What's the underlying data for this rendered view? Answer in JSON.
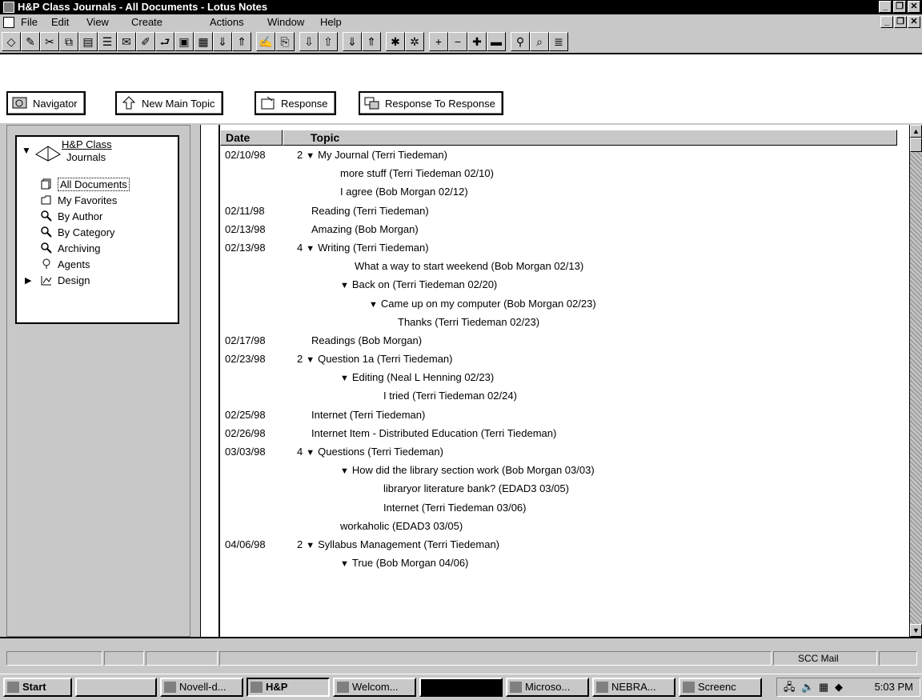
{
  "window": {
    "title": "H&P Class Journals - All Documents - Lotus Notes"
  },
  "menu": [
    {
      "label": "File"
    },
    {
      "label": "Edit"
    },
    {
      "label": "View"
    },
    {
      "label": "Create"
    },
    {
      "label": "Actions"
    },
    {
      "label": "Window"
    },
    {
      "label": "Help"
    }
  ],
  "action_buttons": [
    {
      "label": "Navigator"
    },
    {
      "label": "New Main Topic"
    },
    {
      "label": "Response"
    },
    {
      "label": "Response To Response"
    }
  ],
  "navigator": {
    "db_title_1": "H&P Class",
    "db_title_2": "Journals",
    "items": [
      {
        "label": "All Documents",
        "icon": "documents-icon",
        "selected": true
      },
      {
        "label": "My Favorites",
        "icon": "folder-icon"
      },
      {
        "label": "By Author",
        "icon": "magnifier-icon"
      },
      {
        "label": "By Category",
        "icon": "magnifier-icon"
      },
      {
        "label": "Archiving",
        "icon": "magnifier-icon"
      },
      {
        "label": "Agents",
        "icon": "agent-icon"
      },
      {
        "label": "Design",
        "icon": "design-icon"
      }
    ]
  },
  "view": {
    "columns": [
      {
        "label": "Date"
      },
      {
        "label": "Topic"
      }
    ],
    "rows": [
      {
        "date": "02/10/98",
        "count": "2",
        "twisty": "▼",
        "text": "My Journal (Terri Tiedeman)",
        "indent": 0
      },
      {
        "date": "",
        "count": "",
        "twisty": "",
        "text": "more stuff  (Terri Tiedeman 02/10)",
        "indent": 3
      },
      {
        "date": "",
        "count": "",
        "twisty": "",
        "text": "I agree  (Bob Morgan 02/12)",
        "indent": 3
      },
      {
        "date": "02/11/98",
        "count": "",
        "twisty": "",
        "text": "Reading (Terri Tiedeman)",
        "indent": 1
      },
      {
        "date": "02/13/98",
        "count": "",
        "twisty": "",
        "text": "Amazing (Bob Morgan)",
        "indent": 1
      },
      {
        "date": "02/13/98",
        "count": "4",
        "twisty": "▼",
        "text": "Writing (Terri Tiedeman)",
        "indent": 0
      },
      {
        "date": "",
        "count": "",
        "twisty": "",
        "text": "What a way to start weekend  (Bob Morgan 02/13)",
        "indent": 4
      },
      {
        "date": "",
        "count": "",
        "twisty": "▼",
        "text": "Back on  (Terri Tiedeman 02/20)",
        "indent": 3
      },
      {
        "date": "",
        "count": "",
        "twisty": "▼",
        "text": "Came up on my computer  (Bob Morgan 02/23)",
        "indent": 5
      },
      {
        "date": "",
        "count": "",
        "twisty": "",
        "text": "Thanks  (Terri Tiedeman 02/23)",
        "indent": 7
      },
      {
        "date": "02/17/98",
        "count": "",
        "twisty": "",
        "text": "Readings (Bob Morgan)",
        "indent": 1
      },
      {
        "date": "02/23/98",
        "count": "2",
        "twisty": "▼",
        "text": "Question 1a (Terri Tiedeman)",
        "indent": 0
      },
      {
        "date": "",
        "count": "",
        "twisty": "▼",
        "text": "Editing  (Neal L Henning 02/23)",
        "indent": 3
      },
      {
        "date": "",
        "count": "",
        "twisty": "",
        "text": "I tried  (Terri Tiedeman 02/24)",
        "indent": 6
      },
      {
        "date": "02/25/98",
        "count": "",
        "twisty": "",
        "text": "Internet (Terri Tiedeman)",
        "indent": 1
      },
      {
        "date": "02/26/98",
        "count": "",
        "twisty": "",
        "text": "Internet Item - Distributed Education (Terri Tiedeman)",
        "indent": 1
      },
      {
        "date": "03/03/98",
        "count": "4",
        "twisty": "▼",
        "text": "Questions (Terri Tiedeman)",
        "indent": 0
      },
      {
        "date": "",
        "count": "",
        "twisty": "▼",
        "text": "How did the library section work   (Bob Morgan 03/03)",
        "indent": 3
      },
      {
        "date": "",
        "count": "",
        "twisty": "",
        "text": "libraryor literature bank?  (EDAD3 03/05)",
        "indent": 6
      },
      {
        "date": "",
        "count": "",
        "twisty": "",
        "text": "Internet  (Terri Tiedeman 03/06)",
        "indent": 6
      },
      {
        "date": "",
        "count": "",
        "twisty": "",
        "text": "workaholic  (EDAD3 03/05)",
        "indent": 3
      },
      {
        "date": "04/06/98",
        "count": "2",
        "twisty": "▼",
        "text": "Syllabus Management (Terri Tiedeman)",
        "indent": 0
      },
      {
        "date": "",
        "count": "",
        "twisty": "▼",
        "text": "True  (Bob Morgan 04/06)",
        "indent": 3
      }
    ]
  },
  "status": {
    "mail": "SCC Mail"
  },
  "taskbar": {
    "start": "Start",
    "buttons": [
      {
        "label": ""
      },
      {
        "label": "Novell-d..."
      },
      {
        "label": "H&P"
      },
      {
        "label": "Welcom..."
      },
      {
        "label": ""
      },
      {
        "label": "Microso..."
      },
      {
        "label": "NEBRA..."
      },
      {
        "label": "Screenc"
      }
    ],
    "time": "5:03 PM"
  }
}
